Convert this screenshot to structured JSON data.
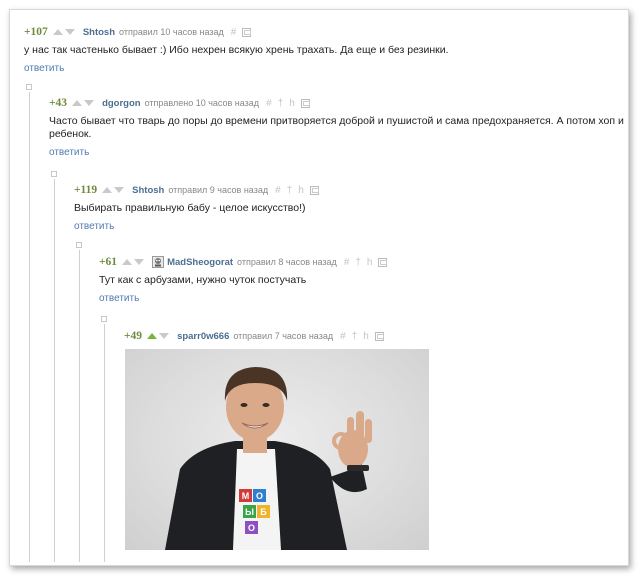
{
  "comments": [
    {
      "rating": "+107",
      "author": "Shtosh",
      "action": "отправил 10 часов назад",
      "text": "у нас так частенько бывает :) Ибо нехрен всякую хрень трахать. Да еще и без резинки.",
      "reply_label": "ответить"
    },
    {
      "rating": "+43",
      "author": "dgorgon",
      "action": "отправлено 10 часов назад",
      "text": "Часто бывает что тварь до поры до времени притворяется доброй и пушистой и сама предохраняется. А потом хоп и ребенок.",
      "reply_label": "ответить"
    },
    {
      "rating": "+119",
      "author": "Shtosh",
      "action": "отправил 9 часов назад",
      "text": "Выбирать правильную бабу - целое искусство!)",
      "reply_label": "ответить"
    },
    {
      "rating": "+61",
      "author": "MadSheogorat",
      "action": "отправил 8 часов назад",
      "text": "Тут как с арбузами, нужно чуток постучать",
      "reply_label": "ответить"
    },
    {
      "rating": "+49",
      "author": "sparr0w666",
      "action": "отправил 7 часов назад"
    }
  ],
  "tools": {
    "hash": "#",
    "pin": "†",
    "hint": "h"
  },
  "photo": {
    "shirt_letters": [
      "М",
      "О",
      "Ы",
      "Б",
      "О"
    ],
    "colors": {
      "suit": "#1f2024",
      "hair": "#4a3426",
      "skin": "#d9a98a",
      "shirt": "#f4f4f4"
    }
  },
  "colors": {
    "rating": "#6e8b3d",
    "author": "#4c6f91",
    "reply": "#4f7bb0",
    "vote_active": "#79b33c"
  }
}
